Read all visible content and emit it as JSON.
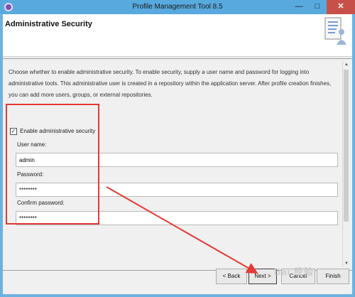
{
  "window": {
    "title": "Profile Management Tool 8.5",
    "minimize": "—",
    "maximize": "□",
    "close": "✕"
  },
  "header": {
    "title": "Administrative Security",
    "graphic_icon": "form-user-icon"
  },
  "description": "Choose whether to enable administrative security. To enable security, supply a user name and password for logging into administrative tools. This administrative user is created in a repository within the application server. After profile creation finishes, you can add more users, groups, or external repositories.",
  "security": {
    "enable_label": "Enable administrative security",
    "enable_checked": true,
    "check_mark": "✓"
  },
  "form": {
    "username": {
      "label": "User name:",
      "value": "admin"
    },
    "password": {
      "label": "Password:",
      "value": "********"
    },
    "confirm": {
      "label": "Confirm password:",
      "value": "********"
    }
  },
  "buttons": {
    "back": "< Back",
    "next": "Next >",
    "cancel": "Cancel",
    "finish": "Finish"
  },
  "scrollbar": {
    "up": "▲",
    "down": "▼"
  },
  "overlay": {
    "watermark": "Bai 经验",
    "annotation_color": "#e53935"
  },
  "colors": {
    "titlebar": "#58a9de",
    "close": "#c7514a",
    "frame_border": "#6db2df"
  }
}
